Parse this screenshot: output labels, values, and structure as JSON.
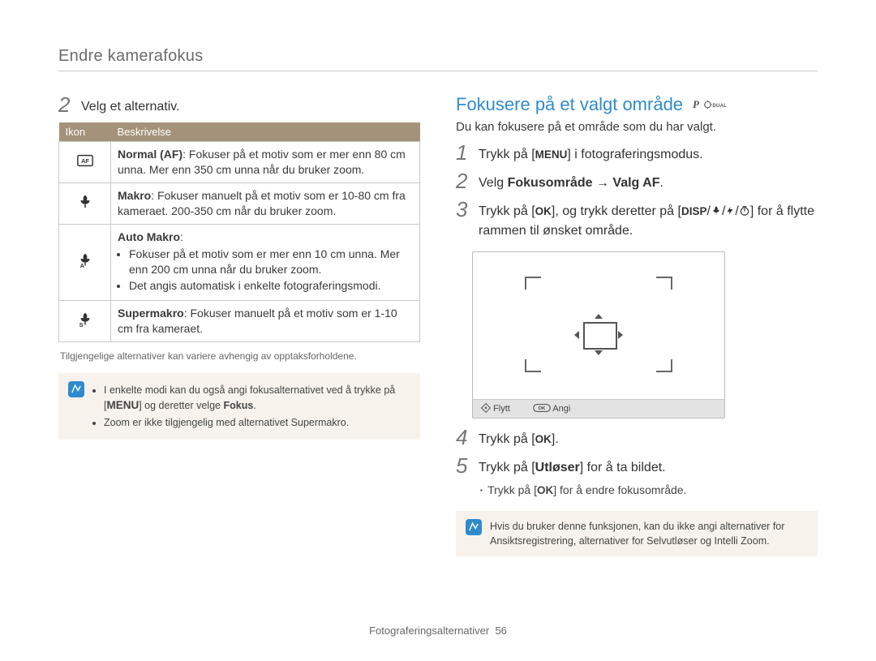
{
  "header": {
    "title": "Endre kamerafokus"
  },
  "left": {
    "step2": {
      "num": "2",
      "text": "Velg et alternativ."
    },
    "table_headers": {
      "icon": "Ikon",
      "desc": "Beskrivelse"
    },
    "rows": [
      {
        "icon": "normal-af-icon",
        "title": "Normal (AF)",
        "text": ": Fokuser på et motiv som er mer enn 80 cm unna. Mer enn 350 cm unna når du bruker zoom."
      },
      {
        "icon": "macro-icon",
        "title": "Makro",
        "text": ": Fokuser manuelt på et motiv som er 10-80 cm fra kameraet. 200-350 cm når du bruker zoom."
      },
      {
        "icon": "auto-macro-icon",
        "title": "Auto Makro",
        "text": ":",
        "bullets": [
          "Fokuser på et motiv som er mer enn 10 cm unna. Mer enn 200 cm unna når du bruker zoom.",
          "Det angis automatisk i enkelte fotograferingsmodi."
        ]
      },
      {
        "icon": "super-macro-icon",
        "title": "Supermakro",
        "text": ": Fokuser manuelt på et motiv som er 1-10 cm fra kameraet."
      }
    ],
    "subnote": "Tilgjengelige alternativer kan variere avhengig av opptaksforholdene.",
    "note": {
      "line1_pre": "I enkelte modi kan du også angi fokusalternativet ved å trykke på [",
      "line1_key": "MENU",
      "line1_mid": "] og deretter velge ",
      "line1_bold": "Fokus",
      "line1_post": ".",
      "line2": "Zoom er ikke tilgjengelig med alternativet Supermakro."
    }
  },
  "right": {
    "title": "Fokusere på et valgt område",
    "modes": {
      "p": "P",
      "dual": "DUAL"
    },
    "intro": "Du kan fokusere på et område som du har valgt.",
    "steps": {
      "s1": {
        "num": "1",
        "pre": "Trykk på [",
        "key": "MENU",
        "post": "] i fotograferingsmodus."
      },
      "s2": {
        "num": "2",
        "pre": "Velg ",
        "bold1": "Fokusområde",
        "arrow": " → ",
        "bold2": "Valg AF",
        "post": "."
      },
      "s3": {
        "num": "3",
        "pre": "Trykk på [",
        "key1": "OK",
        "mid1": "], og trykk deretter på [",
        "key2": "DISP",
        "mid2": "/",
        "iconA": "macro-icon",
        "mid3": "/",
        "iconB": "flash-icon",
        "mid4": "/",
        "iconC": "timer-icon",
        "post": "] for å flytte rammen til ønsket område."
      },
      "s4": {
        "num": "4",
        "pre": "Trykk på [",
        "key": "OK",
        "post": "]."
      },
      "s5": {
        "num": "5",
        "pre": "Trykk på [",
        "bold": "Utløser",
        "post": "] for å ta bildet."
      },
      "s5_bullet": {
        "pre": "Trykk på [",
        "key": "OK",
        "post": "] for å endre fokusområde."
      }
    },
    "lcd": {
      "move": "Flytt",
      "set": "Angi",
      "move_icon": "nav-diamond-icon",
      "set_icon": "ok-pill-icon"
    },
    "note": "Hvis du bruker denne funksjonen, kan du ikke angi alternativer for Ansiktsregistrering, alternativer for Selvutløser og Intelli Zoom."
  },
  "footer": {
    "section": "Fotograferingsalternativer",
    "page": "56"
  }
}
